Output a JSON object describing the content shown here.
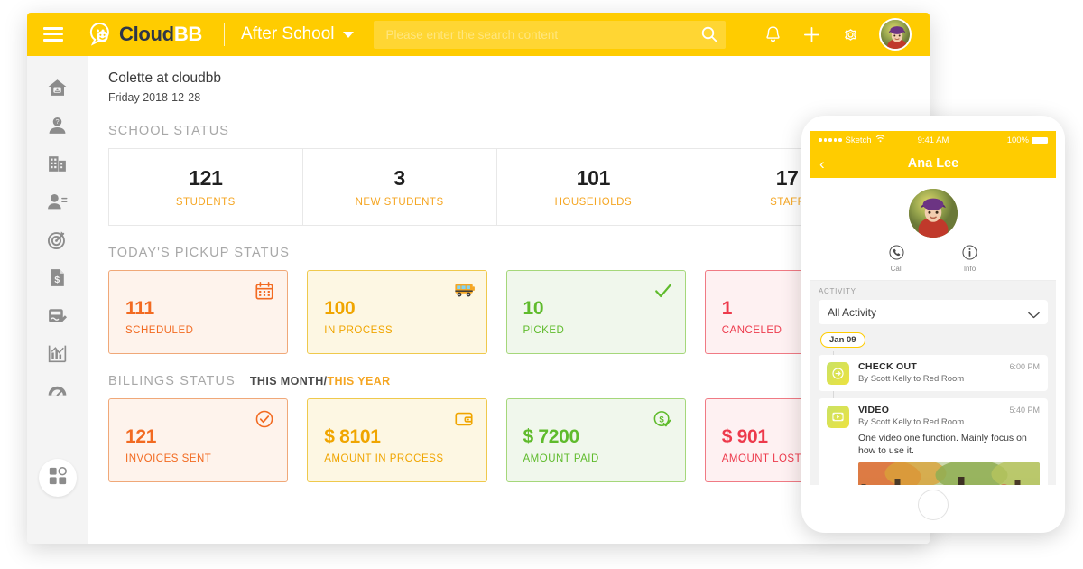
{
  "header": {
    "menu_icon": "hamburger-icon",
    "brand_primary": "Cloud",
    "brand_secondary": "BB",
    "school_name": "After School",
    "search_placeholder": "Please enter the search content",
    "search_value": "",
    "search_icon": "search-icon",
    "notification_icon": "bell-icon",
    "add_icon": "plus-icon",
    "settings_icon": "gear-icon",
    "avatar": "user-avatar",
    "bg_color": "#FFCC00"
  },
  "sidebar": {
    "items": [
      {
        "icon": "home-icon",
        "name": "home"
      },
      {
        "icon": "student-icon",
        "name": "students"
      },
      {
        "icon": "building-icon",
        "name": "school"
      },
      {
        "icon": "contact-icon",
        "name": "staff"
      },
      {
        "icon": "target-icon",
        "name": "goals"
      },
      {
        "icon": "invoice-dollar-icon",
        "name": "billing"
      },
      {
        "icon": "signature-icon",
        "name": "forms"
      },
      {
        "icon": "bar-chart-icon",
        "name": "reports"
      },
      {
        "icon": "gauge-icon",
        "name": "dashboard"
      }
    ],
    "apps_icon": "apps-grid-icon"
  },
  "page": {
    "title": "Colette at cloudbb",
    "date": "Friday 2018-12-28"
  },
  "school_status": {
    "label": "SCHOOL STATUS",
    "cells": [
      {
        "value": "121",
        "caption": "STUDENTS"
      },
      {
        "value": "3",
        "caption": "NEW STUDENTS"
      },
      {
        "value": "101",
        "caption": "HOUSEHOLDS"
      },
      {
        "value": "17",
        "caption": "STAFF"
      }
    ]
  },
  "pickup_status": {
    "label": "TODAY'S PICKUP STATUS",
    "cards": [
      {
        "value": "111",
        "caption": "SCHEDULED",
        "icon": "calendar-icon",
        "color": "#F26A21"
      },
      {
        "value": "100",
        "caption": "IN PROCESS",
        "icon": "school-bus-icon",
        "color": "#F0A500"
      },
      {
        "value": "10",
        "caption": "PICKED",
        "icon": "check-icon",
        "color": "#5FBB2C"
      },
      {
        "value": "1",
        "caption": "CANCELED",
        "icon": "none",
        "color": "#ED3A4C"
      }
    ]
  },
  "billings_status": {
    "label": "BILLINGS STATUS",
    "toggle_selected": "THIS MONTH",
    "toggle_separator": "/",
    "toggle_other": "THIS YEAR",
    "cards": [
      {
        "value": "121",
        "caption": "INVOICES SENT",
        "icon": "check-circle-icon",
        "color": "#F26A21"
      },
      {
        "value": "$ 8101",
        "caption": "AMOUNT IN PROCESS",
        "icon": "wallet-icon",
        "color": "#F0A500"
      },
      {
        "value": "$ 7200",
        "caption": "AMOUNT PAID",
        "icon": "dollar-check-icon",
        "color": "#5FBB2C"
      },
      {
        "value": "$ 901",
        "caption": "AMOUNT LOST",
        "icon": "none",
        "color": "#ED3A4C"
      }
    ]
  },
  "phone": {
    "status_carrier": "Sketch",
    "status_time": "9:41 AM",
    "status_battery": "100%",
    "wifi_icon": "wifi-icon",
    "back_icon": "chevron-left-icon",
    "nav_title": "Ana Lee",
    "avatar": "student-avatar",
    "actions": [
      {
        "label": "Call",
        "icon": "phone-circle-icon"
      },
      {
        "label": "Info",
        "icon": "info-circle-icon"
      }
    ],
    "activity_label": "ACTIVITY",
    "filter_value": "All Activity",
    "filter_chevron": "chevron-down-icon",
    "date_pill": "Jan 09",
    "items": [
      {
        "title": "CHECK OUT",
        "subtitle": "By Scott Kelly to Red Room",
        "time": "6:00 PM",
        "icon": "check-out-arrow-icon",
        "body": "",
        "thumbnail": ""
      },
      {
        "title": "VIDEO",
        "subtitle": "By Scott Kelly to Red Room",
        "time": "5:40 PM",
        "icon": "video-icon",
        "body": "One video one function. Mainly focus on how to use it.",
        "thumbnail": "autumn-park-video-thumbnail"
      }
    ],
    "home_button": "home-button"
  }
}
